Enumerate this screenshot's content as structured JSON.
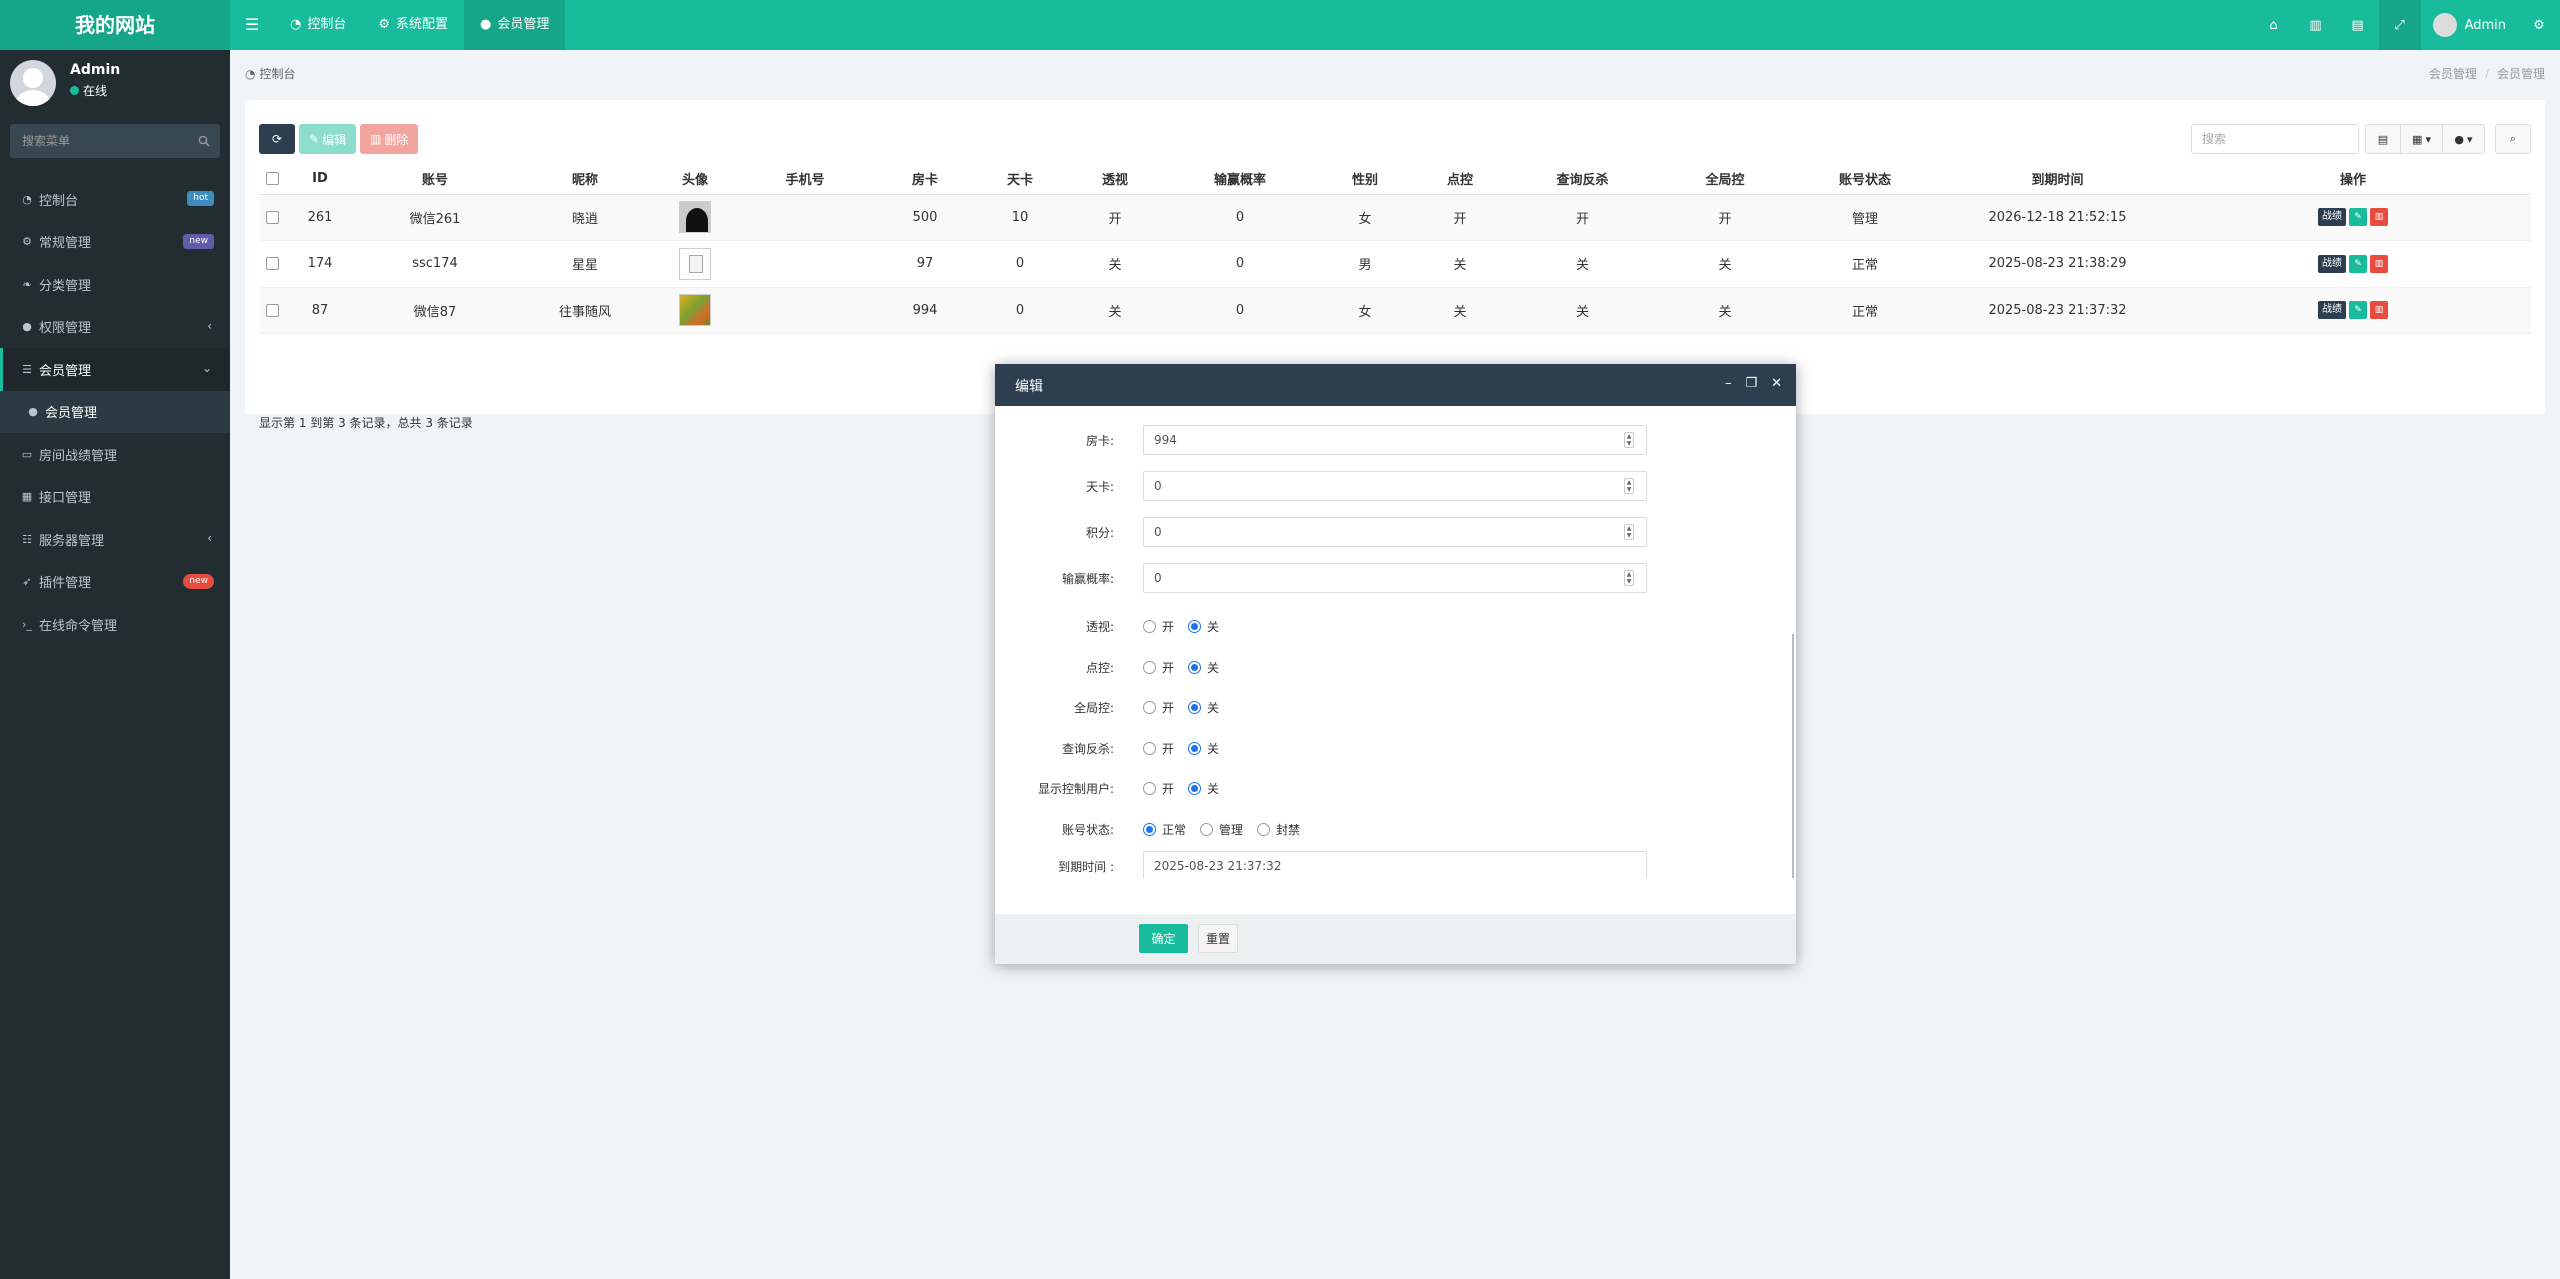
{
  "brand": {
    "title": "我的网站",
    "accent": "#18bc9c",
    "dark": "#222d32"
  },
  "topnav": {
    "tabs": [
      {
        "icon": "dashboard-icon",
        "label": "控制台"
      },
      {
        "icon": "gears-icon",
        "label": "系统配置"
      },
      {
        "icon": "user-icon",
        "label": "会员管理"
      }
    ],
    "active_tab": "会员管理",
    "user_name": "Admin"
  },
  "sidebar": {
    "user": {
      "name": "Admin",
      "status": "在线"
    },
    "search_placeholder": "搜索菜单",
    "items": [
      {
        "label": "控制台",
        "icon": "dashboard-icon",
        "badge": "hot"
      },
      {
        "label": "常规管理",
        "icon": "cogs-icon",
        "badge": "new"
      },
      {
        "label": "分类管理",
        "icon": "leaf-icon"
      },
      {
        "label": "权限管理",
        "icon": "group-icon"
      },
      {
        "label": "会员管理",
        "icon": "list-icon"
      },
      {
        "label": "会员管理",
        "icon": "user-icon"
      },
      {
        "label": "房间战绩管理",
        "icon": "file-icon"
      },
      {
        "label": "接口管理",
        "icon": "table-icon"
      },
      {
        "label": "服务器管理",
        "icon": "database-icon"
      },
      {
        "label": "插件管理",
        "icon": "rocket-icon",
        "badge": "new"
      },
      {
        "label": "在线命令管理",
        "icon": "terminal-icon"
      }
    ]
  },
  "breadcrumb": {
    "home": "控制台",
    "path": [
      "会员管理",
      "会员管理"
    ]
  },
  "toolbar": {
    "edit_label": "编辑",
    "delete_label": "删除",
    "search_placeholder": "搜索"
  },
  "table": {
    "columns": [
      "ID",
      "账号",
      "昵称",
      "头像",
      "手机号",
      "房卡",
      "天卡",
      "透视",
      "输赢概率",
      "性别",
      "点控",
      "查询反杀",
      "全局控",
      "账号状态",
      "到期时间",
      "操作"
    ],
    "rows": [
      {
        "id": "261",
        "account": "微信261",
        "nickname": "晓逍",
        "phone": "",
        "room_card": "500",
        "day_card": "10",
        "xray": "开",
        "win_rate": "0",
        "gender": "女",
        "point_ctrl": "开",
        "query_kill": "开",
        "global_ctrl": "开",
        "status": "管理",
        "expire": "2026-12-18 21:52:15"
      },
      {
        "id": "174",
        "account": "ssc174",
        "nickname": "星星",
        "phone": "",
        "room_card": "97",
        "day_card": "0",
        "xray": "关",
        "win_rate": "0",
        "gender": "男",
        "point_ctrl": "关",
        "query_kill": "关",
        "global_ctrl": "关",
        "status": "正常",
        "expire": "2025-08-23 21:38:29"
      },
      {
        "id": "87",
        "account": "微信87",
        "nickname": "往事随风",
        "phone": "",
        "room_card": "994",
        "day_card": "0",
        "xray": "关",
        "win_rate": "0",
        "gender": "女",
        "point_ctrl": "关",
        "query_kill": "关",
        "global_ctrl": "关",
        "status": "正常",
        "expire": "2025-08-23 21:37:32"
      }
    ],
    "op_label": "战绩",
    "summary": "显示第 1 到第 3 条记录，总共 3 条记录"
  },
  "dialog": {
    "title": "编辑",
    "fields": [
      {
        "label": "房卡:",
        "value": "994"
      },
      {
        "label": "天卡:",
        "value": "0"
      },
      {
        "label": "积分:",
        "value": "0"
      },
      {
        "label": "输赢概率:",
        "value": "0"
      }
    ],
    "radio_groups": [
      {
        "label": "透视:",
        "options": [
          "开",
          "关"
        ],
        "selected": "关"
      },
      {
        "label": "点控:",
        "options": [
          "开",
          "关"
        ],
        "selected": "关"
      },
      {
        "label": "全局控:",
        "options": [
          "开",
          "关"
        ],
        "selected": "关"
      },
      {
        "label": "查询反杀:",
        "options": [
          "开",
          "关"
        ],
        "selected": "关"
      },
      {
        "label": "显示控制用户:",
        "options": [
          "开",
          "关"
        ],
        "selected": "关"
      },
      {
        "label": "账号状态:",
        "options": [
          "正常",
          "管理",
          "封禁"
        ],
        "selected": "正常"
      }
    ],
    "expire": {
      "label": "到期时间 :",
      "value": "2025-08-23 21:37:32"
    },
    "ok_label": "确定",
    "reset_label": "重置"
  }
}
